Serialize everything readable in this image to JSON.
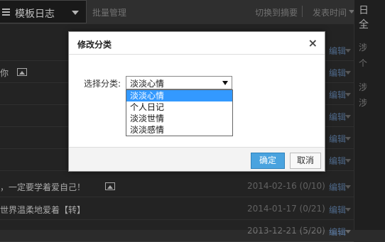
{
  "topbar": {
    "template_label": "模板日志",
    "batch_manage": "批量管理",
    "switch_summary": "切换到摘要",
    "sort_label": "发表时间"
  },
  "right_panel": {
    "chars": [
      "日",
      "全",
      "涉",
      "个",
      "涉",
      "涉"
    ]
  },
  "rows": [
    {
      "text": "",
      "date": "",
      "edit": "编辑"
    },
    {
      "text": "你",
      "has_image": true,
      "date": "",
      "edit": "编辑"
    },
    {
      "text": "",
      "date": "",
      "edit": "编辑"
    },
    {
      "text": "",
      "date": "",
      "edit": "编辑"
    },
    {
      "text": "",
      "date": "",
      "edit": "编辑"
    },
    {
      "text": "",
      "date": "",
      "edit": "编辑"
    },
    {
      "text": "，一定要学着爱自己！",
      "has_image": true,
      "date": "2014-02-16  (0/10)",
      "edit": "编辑"
    },
    {
      "text": "世界温柔地爱着【转】",
      "date": "2014-01-17  (0/21)",
      "edit": "编辑"
    },
    {
      "text": "",
      "date": "2013-12-21  (5/20)",
      "edit": "编辑"
    }
  ],
  "dialog": {
    "title": "修改分类",
    "close": "×",
    "field_label": "选择分类:",
    "selected_value": "淡淡心情",
    "options": [
      "淡淡心情",
      "个人日记",
      "淡淡世情",
      "淡淡感情"
    ],
    "ok_label": "确定",
    "cancel_label": "取消"
  }
}
